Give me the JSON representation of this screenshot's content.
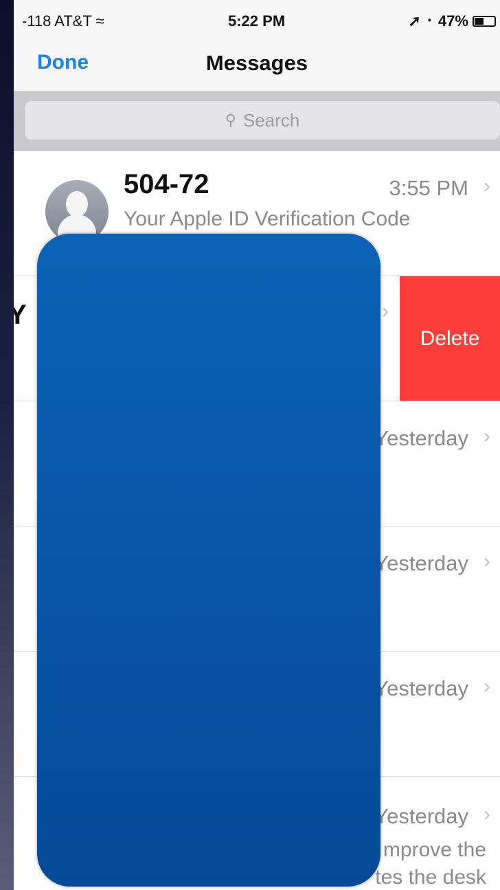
{
  "status_bar": {
    "carrier": "-118 AT&T",
    "time": "5:22 PM",
    "battery_percent": "47%",
    "battery_level": 0.47
  },
  "nav": {
    "done_label": "Done",
    "title": "Messages"
  },
  "search": {
    "placeholder": "Search"
  },
  "messages": [
    {
      "sender": "504-72",
      "preview": "Your Apple ID Verification Code",
      "time": "3:55 PM"
    },
    {
      "sender": "Y",
      "preview": "",
      "time": ""
    },
    {
      "sender": "",
      "preview": "",
      "time": "Yesterday"
    },
    {
      "sender": "",
      "preview": "",
      "time": "Yesterday"
    },
    {
      "sender": "",
      "preview": "",
      "time": "Yesterday"
    },
    {
      "sender": "",
      "preview": "mprove the",
      "preview2": "tes the desk",
      "time": "Yesterday"
    }
  ],
  "actions": {
    "delete_label": "Delete"
  },
  "colors": {
    "accent": "#1a82f7",
    "delete": "#fc3d39",
    "redaction": "#0854a6"
  }
}
